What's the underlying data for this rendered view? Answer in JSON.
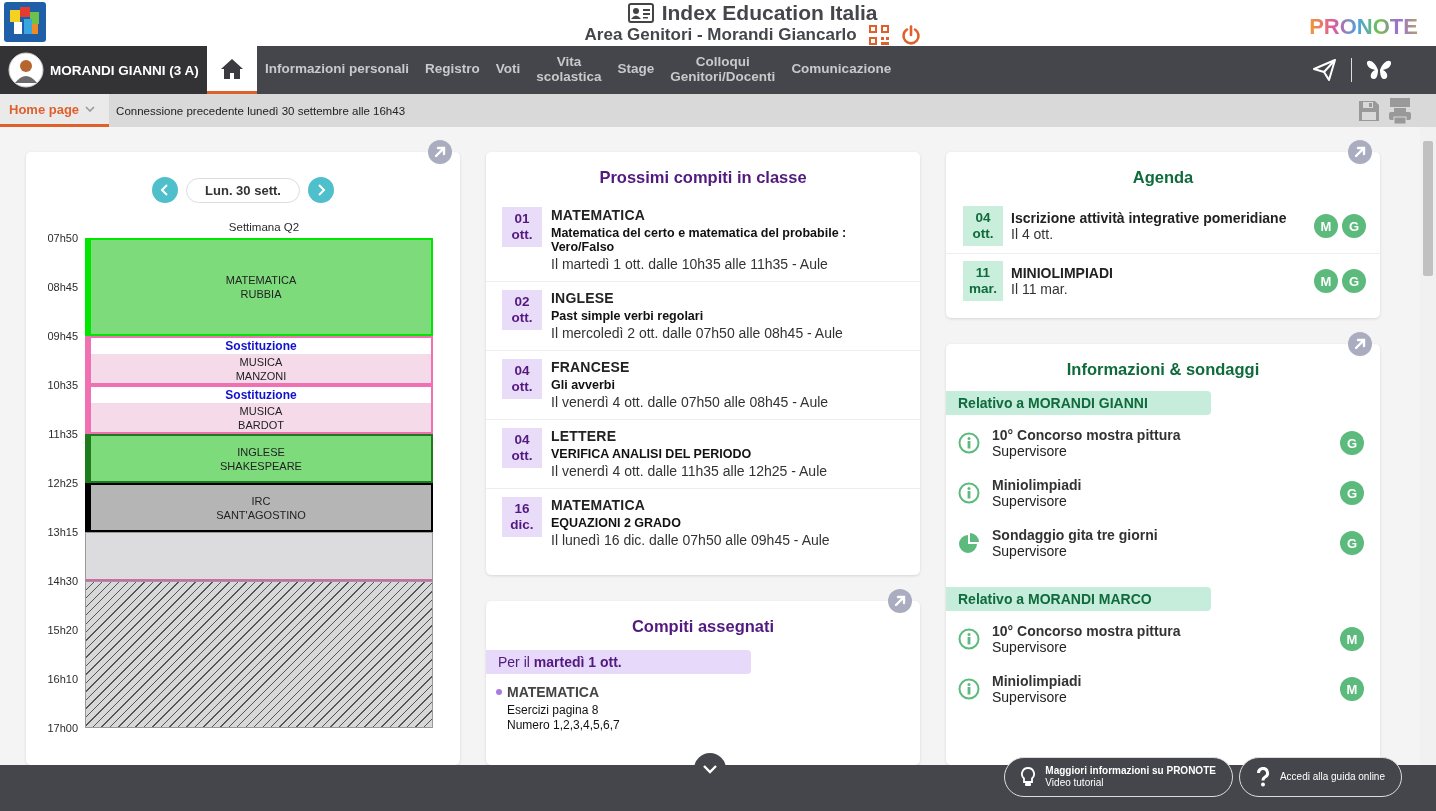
{
  "header": {
    "title": "Index Education Italia",
    "subtitle": "Area Genitori - Morandi Giancarlo",
    "brand": "PRONOTE"
  },
  "nav": {
    "user": "MORANDI GIANNI (3 A)",
    "items": [
      {
        "kind": "home",
        "selected": true
      },
      {
        "kind": "text",
        "lines": [
          "Informazioni personali"
        ],
        "selected": false
      },
      {
        "kind": "text",
        "lines": [
          "Registro"
        ],
        "selected": false
      },
      {
        "kind": "text",
        "lines": [
          "Voti"
        ],
        "selected": false
      },
      {
        "kind": "text",
        "lines": [
          "Vita",
          "scolastica"
        ],
        "selected": false
      },
      {
        "kind": "text",
        "lines": [
          "Stage"
        ],
        "selected": false
      },
      {
        "kind": "text",
        "lines": [
          "Colloqui",
          "Genitori/Docenti"
        ],
        "selected": false
      },
      {
        "kind": "text",
        "lines": [
          "Comunicazione"
        ],
        "selected": false
      }
    ]
  },
  "subbar": {
    "menu": "Home page",
    "last_login": "Connessione precedente lunedì 30 settembre alle 16h43"
  },
  "timetable": {
    "date": "Lun. 30 sett.",
    "week": "Settimana Q2",
    "hours": [
      {
        "time": "07h50",
        "block": {
          "kind": "lesson",
          "subject": "MATEMATICA",
          "teacher": "RUBBIA",
          "color": "#00e600"
        }
      },
      {
        "time": "08h45"
      },
      {
        "time": "09h45",
        "block": {
          "kind": "substitution",
          "label": "Sostituzione",
          "subject": "MUSICA",
          "teacher": "MANZONI",
          "color": "#f070b4"
        }
      },
      {
        "time": "10h35",
        "block": {
          "kind": "substitution",
          "label": "Sostituzione",
          "subject": "MUSICA",
          "teacher": "BARDOT",
          "color": "#f070b4"
        }
      },
      {
        "time": "11h35",
        "block": {
          "kind": "lesson",
          "subject": "INGLESE",
          "teacher": "SHAKESPEARE",
          "color": "#1d7a1d"
        }
      },
      {
        "time": "12h25",
        "block": {
          "kind": "optional",
          "subject": "IRC",
          "teacher": "SANT'AGOSTINO",
          "color": "#000000"
        }
      },
      {
        "time": "13h15",
        "block": {
          "kind": "free"
        }
      },
      {
        "time": "14h30",
        "block": {
          "kind": "closed"
        }
      },
      {
        "time": "15h20"
      },
      {
        "time": "16h10"
      },
      {
        "time": "17h00"
      }
    ]
  },
  "tests": {
    "title": "Prossimi compiti in classe",
    "items": [
      {
        "day": "01",
        "month": "ott.",
        "subject": "MATEMATICA",
        "topic": "Matematica del certo e matematica del probabile : Vero/Falso",
        "when": "Il martedì 1 ott. dalle 10h35 alle 11h35 - Aule"
      },
      {
        "day": "02",
        "month": "ott.",
        "subject": "INGLESE",
        "topic": "Past simple verbi regolari",
        "when": "Il mercoledì 2 ott. dalle 07h50 alle 08h45 - Aule"
      },
      {
        "day": "04",
        "month": "ott.",
        "subject": "FRANCESE",
        "topic": "Gli avverbi",
        "when": "Il venerdì 4 ott. dalle 07h50 alle 08h45 - Aule"
      },
      {
        "day": "04",
        "month": "ott.",
        "subject": "LETTERE",
        "topic": "VERIFICA ANALISI DEL PERIODO",
        "when": "Il venerdì 4 ott. dalle 11h35 alle 12h25 - Aule"
      },
      {
        "day": "16",
        "month": "dic.",
        "subject": "MATEMATICA",
        "topic": "EQUAZIONI 2 GRADO",
        "when": "Il lunedì 16 dic. dalle 07h50 alle 09h45 - Aule"
      }
    ]
  },
  "homework": {
    "title": "Compiti assegnati",
    "group": "Per il **martedì 1 ott.**",
    "items": [
      {
        "subject": "MATEMATICA",
        "lines": [
          "Esercizi pagina 8",
          "Numero 1,2,3,4,5,6,7"
        ]
      }
    ]
  },
  "agenda": {
    "title": "Agenda",
    "items": [
      {
        "day": "04",
        "month": "ott.",
        "title": "Iscrizione attività integrative pomeridiane",
        "date": "Il 4 ott.",
        "people": [
          "M",
          "G"
        ]
      },
      {
        "day": "11",
        "month": "mar.",
        "title": "MINIOLIMPIADI",
        "date": "Il 11 mar.",
        "people": [
          "M",
          "G"
        ]
      }
    ]
  },
  "info": {
    "title": "Informazioni & sondaggi",
    "groups": [
      {
        "label": "Relativo a MORANDI GIANNI",
        "items": [
          {
            "kind": "info",
            "title": "10° Concorso mostra pittura",
            "author": "Supervisore",
            "person": "G"
          },
          {
            "kind": "info",
            "title": "Miniolimpiadi",
            "author": "Supervisore",
            "person": "G"
          },
          {
            "kind": "poll",
            "title": "Sondaggio gita tre giorni",
            "author": "Supervisore",
            "person": "G"
          }
        ]
      },
      {
        "label": "Relativo a MORANDI MARCO",
        "items": [
          {
            "kind": "info",
            "title": "10° Concorso mostra pittura",
            "author": "Supervisore",
            "person": "M"
          },
          {
            "kind": "info",
            "title": "Miniolimpiadi",
            "author": "Supervisore",
            "person": "M"
          }
        ]
      }
    ]
  },
  "footer": {
    "buttons": [
      {
        "kind": "tips",
        "title": "Maggiori informazioni su PRONOTE",
        "subtitle": "Video tutorial"
      },
      {
        "kind": "help",
        "title": "Accedi alla guida online"
      }
    ]
  }
}
